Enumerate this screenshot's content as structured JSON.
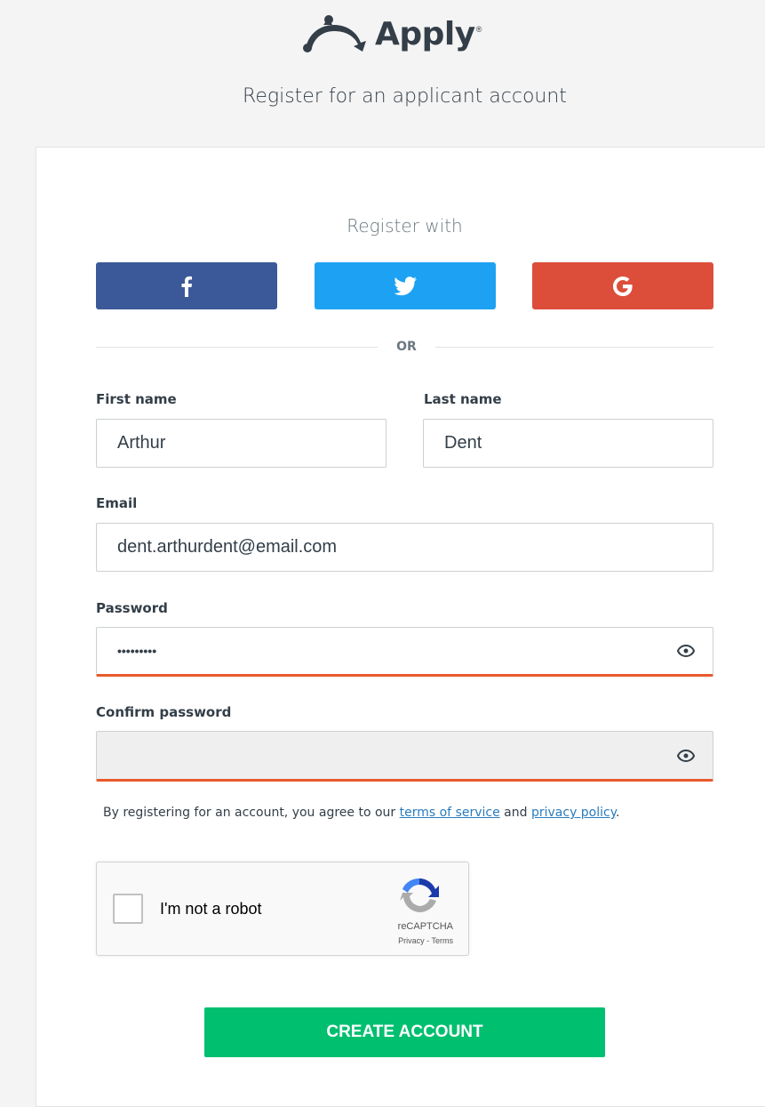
{
  "header": {
    "logo_text": "Apply",
    "logo_reg": "®",
    "subtitle": "Register for an applicant account"
  },
  "social": {
    "heading": "Register with",
    "buttons": [
      {
        "name": "facebook",
        "icon": "facebook-icon",
        "color": "#3b5998"
      },
      {
        "name": "twitter",
        "icon": "twitter-icon",
        "color": "#1da1f2"
      },
      {
        "name": "google",
        "icon": "google-icon",
        "color": "#dc4e3a"
      }
    ],
    "divider_text": "OR"
  },
  "form": {
    "first_name": {
      "label": "First name",
      "value": "Arthur"
    },
    "last_name": {
      "label": "Last name",
      "value": "Dent"
    },
    "email": {
      "label": "Email",
      "value": "dent.arthurdent@email.com"
    },
    "password": {
      "label": "Password",
      "value": "•••••••••",
      "icon": "eye-icon"
    },
    "confirm_password": {
      "label": "Confirm password",
      "value": "",
      "icon": "eye-icon"
    },
    "error_color": "#e85a2c"
  },
  "agreement": {
    "prefix": "By registering for an account, you agree to our ",
    "terms_link": "terms of service",
    "middle": " and ",
    "privacy_link": "privacy policy",
    "suffix": "."
  },
  "captcha": {
    "label": "I'm not a robot",
    "brand": "reCAPTCHA",
    "privacy": "Privacy",
    "separator": " - ",
    "terms": "Terms"
  },
  "submit": {
    "label": "CREATE ACCOUNT",
    "color": "#00bf6f"
  }
}
